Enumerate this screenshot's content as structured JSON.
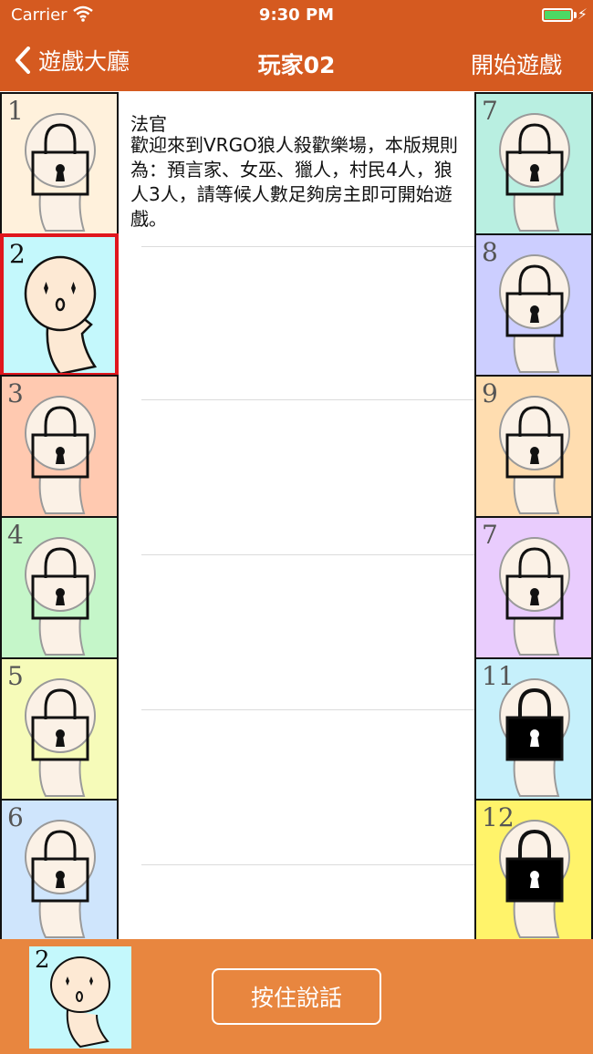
{
  "status_bar": {
    "carrier": "Carrier",
    "time": "9:30 PM"
  },
  "nav": {
    "back_label": "遊戲大廳",
    "title": "玩家02",
    "start_label": "開始遊戲"
  },
  "players": [
    {
      "number": "1",
      "bg": "#fff1dc",
      "status": "locked"
    },
    {
      "number": "2",
      "bg": "#c4f8fc",
      "status": "current"
    },
    {
      "number": "3",
      "bg": "#ffc9b0",
      "status": "locked"
    },
    {
      "number": "4",
      "bg": "#c5f6c9",
      "status": "locked"
    },
    {
      "number": "5",
      "bg": "#f6fbb9",
      "status": "locked"
    },
    {
      "number": "6",
      "bg": "#cfe5fc",
      "status": "locked"
    },
    {
      "number": "7",
      "bg": "#b9efe1",
      "status": "locked"
    },
    {
      "number": "8",
      "bg": "#ccceff",
      "status": "locked"
    },
    {
      "number": "9",
      "bg": "#ffddb0",
      "status": "locked"
    },
    {
      "number": "7",
      "bg": "#e9ccfd",
      "status": "locked"
    },
    {
      "number": "11",
      "bg": "#c6f0fb",
      "status": "locked-filled"
    },
    {
      "number": "12",
      "bg": "#fff36a",
      "status": "locked-filled"
    }
  ],
  "chat": {
    "speaker": "法官",
    "message": "歡迎來到VRGO狼人殺歡樂場，本版規則為：預言家、女巫、獵人，村民4人，狼人3人，請等候人數足夠房主即可開始遊戲。"
  },
  "bottom": {
    "talk_label": "按住說話",
    "avatar_number": "2"
  }
}
